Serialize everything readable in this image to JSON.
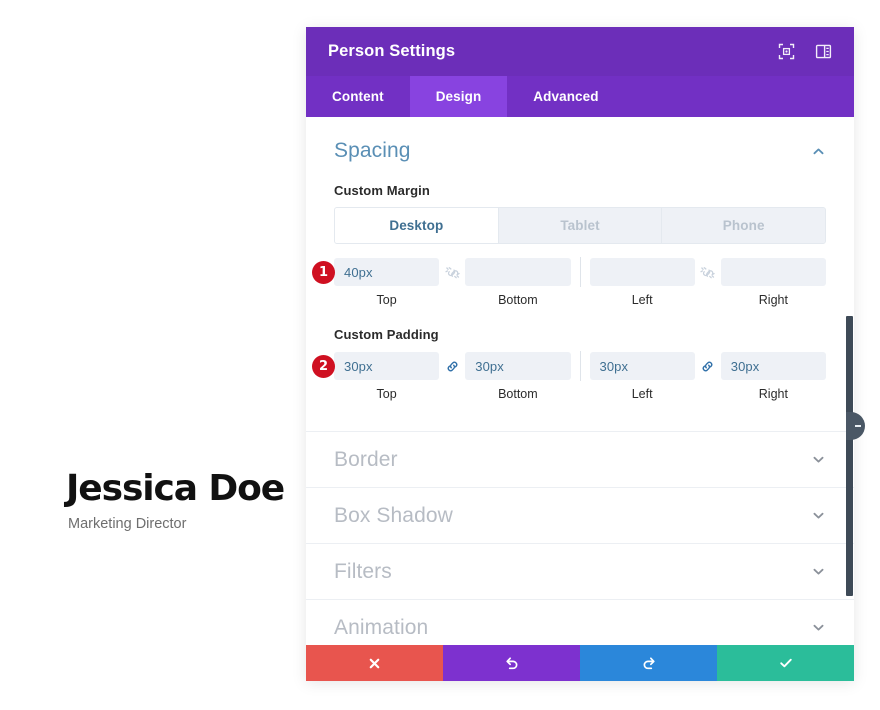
{
  "preview": {
    "name": "Jessica Doe",
    "role": "Marketing Director"
  },
  "modal": {
    "title": "Person Settings",
    "header_icons": [
      {
        "name": "fullscreen-icon",
        "label": "Expand"
      },
      {
        "name": "layout-toggle-icon",
        "label": "Layout"
      }
    ],
    "tabs": [
      {
        "label": "Content",
        "active": false
      },
      {
        "label": "Design",
        "active": true
      },
      {
        "label": "Advanced",
        "active": false
      }
    ],
    "spacing": {
      "title": "Spacing",
      "expanded": true,
      "chevron": "chevron-up-icon",
      "custom_margin": {
        "label": "Custom Margin",
        "badge": "1",
        "devices": [
          {
            "label": "Desktop",
            "active": true
          },
          {
            "label": "Tablet",
            "active": false
          },
          {
            "label": "Phone",
            "active": false
          }
        ],
        "link_left": {
          "state": "unlinked",
          "icon": "broken-chain-icon"
        },
        "link_right": {
          "state": "unlinked",
          "icon": "broken-chain-icon"
        },
        "fields": [
          {
            "label": "Top",
            "value": "40px"
          },
          {
            "label": "Bottom",
            "value": ""
          },
          {
            "label": "Left",
            "value": ""
          },
          {
            "label": "Right",
            "value": ""
          }
        ]
      },
      "custom_padding": {
        "label": "Custom Padding",
        "badge": "2",
        "link_left": {
          "state": "linked",
          "icon": "chain-link-icon"
        },
        "link_right": {
          "state": "linked",
          "icon": "chain-link-icon"
        },
        "fields": [
          {
            "label": "Top",
            "value": "30px"
          },
          {
            "label": "Bottom",
            "value": "30px"
          },
          {
            "label": "Left",
            "value": "30px"
          },
          {
            "label": "Right",
            "value": "30px"
          }
        ]
      }
    },
    "collapsed_sections": [
      {
        "title": "Border",
        "chevron": "chevron-down-icon"
      },
      {
        "title": "Box Shadow",
        "chevron": "chevron-down-icon"
      },
      {
        "title": "Filters",
        "chevron": "chevron-down-icon"
      },
      {
        "title": "Animation",
        "chevron": "chevron-down-icon"
      }
    ],
    "actions": [
      {
        "name": "cancel-button",
        "icon": "close-x-icon",
        "color": "#e8554e"
      },
      {
        "name": "undo-button",
        "icon": "undo-arrow-icon",
        "color": "#7d31cf"
      },
      {
        "name": "redo-button",
        "icon": "redo-arrow-icon",
        "color": "#2b87da"
      },
      {
        "name": "save-button",
        "icon": "checkmark-icon",
        "color": "#2bbd9a"
      }
    ]
  },
  "colors": {
    "header_purple": "#6c2eb9",
    "tab_bar_purple": "#7230c4",
    "tab_active_purple": "#8843e0",
    "section_title_blue": "#5a8fb5",
    "badge_red": "#cf1021",
    "input_bg": "#eef1f6",
    "link_active_blue": "#2f6fa8"
  }
}
